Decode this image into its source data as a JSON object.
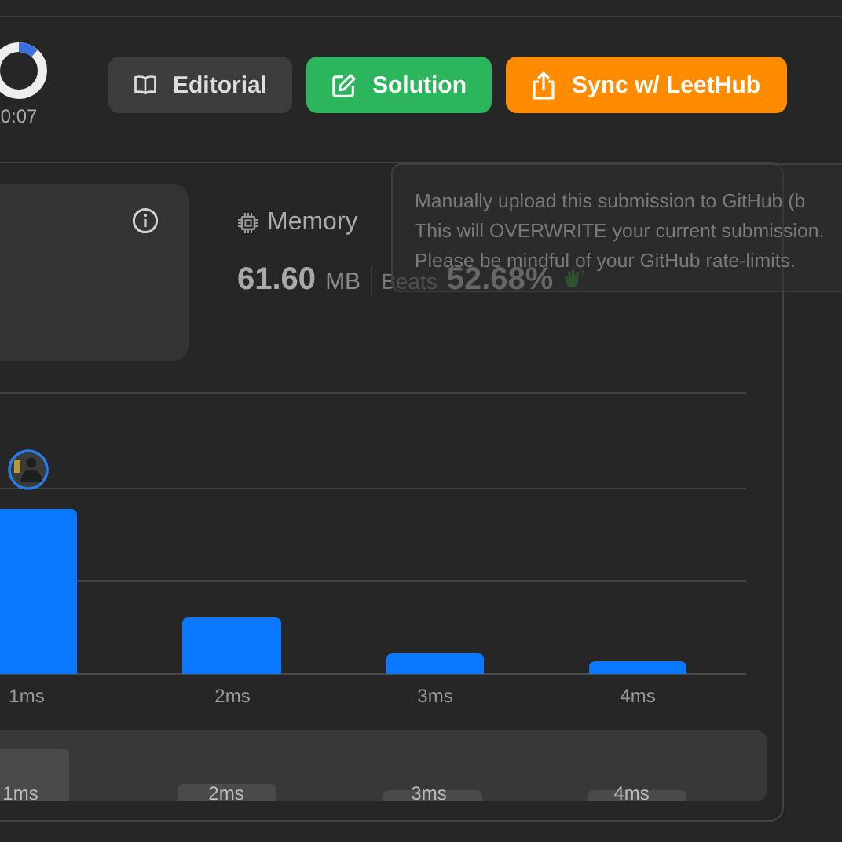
{
  "timer": "0:07",
  "buttons": [
    {
      "label": "Editorial",
      "kind": "editorial"
    },
    {
      "label": "Solution",
      "kind": "solution"
    },
    {
      "label": "Sync w/ LeetHub",
      "kind": "sync"
    }
  ],
  "memory": {
    "label": "Memory",
    "value": "61.60",
    "unit": "MB",
    "beats_label": "Beats",
    "beats": "52.68%"
  },
  "tooltip": {
    "lines": [
      "Manually upload this submission to GitHub (b",
      "This will OVERWRITE your current submission.",
      "Please be mindful of your GitHub rate-limits."
    ]
  },
  "chart": {
    "labels": [
      "1ms",
      "2ms",
      "3ms",
      "4ms"
    ]
  },
  "range_chart": {
    "labels": [
      "1ms",
      "2ms",
      "3ms",
      "4ms"
    ]
  }
}
